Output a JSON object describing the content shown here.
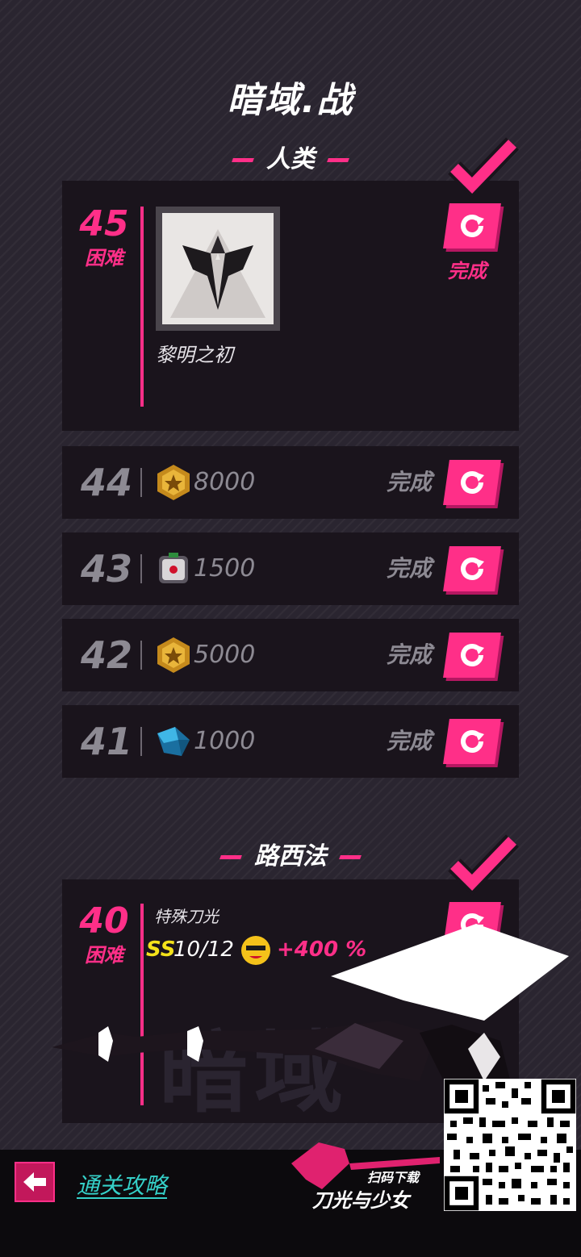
{
  "title": "暗域.战",
  "sections": [
    {
      "name": "人类",
      "featured": {
        "level": "45",
        "difficulty": "困难",
        "reward_name": "黎明之初",
        "status": "完成"
      },
      "rows": [
        {
          "level": "44",
          "reward_icon": "gold-coin-icon",
          "amount": "8000",
          "status": "完成"
        },
        {
          "level": "43",
          "reward_icon": "robot-head-icon",
          "amount": "1500",
          "status": "完成"
        },
        {
          "level": "42",
          "reward_icon": "gold-coin-icon",
          "amount": "5000",
          "status": "完成"
        },
        {
          "level": "41",
          "reward_icon": "blue-crystal-icon",
          "amount": "1000",
          "status": "完成"
        }
      ]
    },
    {
      "name": "路西法",
      "featured": {
        "level": "40",
        "difficulty": "困难",
        "reward_type": "特殊刀光",
        "rank": "SS",
        "progress": "10/12",
        "bonus": "+400 %",
        "watermark": "暗域"
      }
    }
  ],
  "footer": {
    "guide_link": "通关攻略",
    "promo_scan": "扫码下载",
    "promo_title": "刀光与少女"
  },
  "colors": {
    "accent": "#ff2f88",
    "panel": "#1a141c",
    "muted_text": "#8d8a93",
    "link": "#35d0c8",
    "rank": "#f4e21a"
  }
}
